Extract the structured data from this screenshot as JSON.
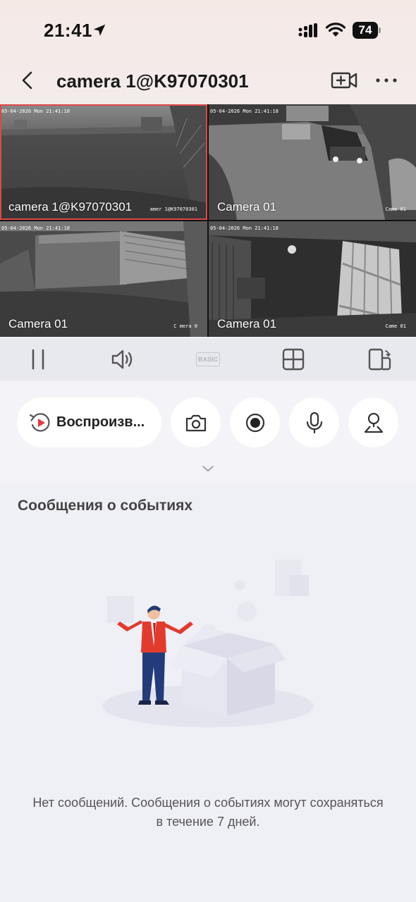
{
  "status_bar": {
    "time": "21:41",
    "battery": "74"
  },
  "nav": {
    "title": "camera 1@K97070301"
  },
  "cameras": [
    {
      "timestamp": "05-04-2026 Mon 21:41:18",
      "name": "camera 1@K97070301",
      "osd": "amer 1@K97070301",
      "selected": true
    },
    {
      "timestamp": "05-04-2026 Mon 21:41:18",
      "name": "Camera 01",
      "osd": "Came   01",
      "selected": false
    },
    {
      "timestamp": "05-04-2026 Mon 21:41:18",
      "name": "Camera 01",
      "osd": "C mera 0",
      "selected": false
    },
    {
      "timestamp": "05-04-2026 Mon 21:41:18",
      "name": "Camera 01",
      "osd": "Came   01",
      "selected": false
    }
  ],
  "controls": {
    "basic_label": "BASIC"
  },
  "actions": {
    "playback_label": "Воспроизв..."
  },
  "events": {
    "title": "Сообщения о событиях",
    "empty_message": "Нет сообщений. Сообщения о событиях могут сохраняться в течение 7 дней."
  },
  "colors": {
    "selected_border": "#e04848",
    "playback_accent": "#e5383b"
  }
}
